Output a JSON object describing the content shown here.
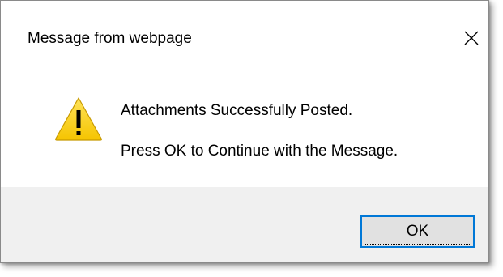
{
  "dialog": {
    "title": "Message from webpage",
    "close_icon": "close-icon",
    "icon": "warning-icon",
    "message_line1": "Attachments Successfully Posted.",
    "message_line2": "Press OK to Continue with the Message.",
    "ok_label": "OK"
  },
  "colors": {
    "accent": "#0078d7",
    "footer_bg": "#f0f0f0",
    "warning_fill": "#fcd116"
  }
}
